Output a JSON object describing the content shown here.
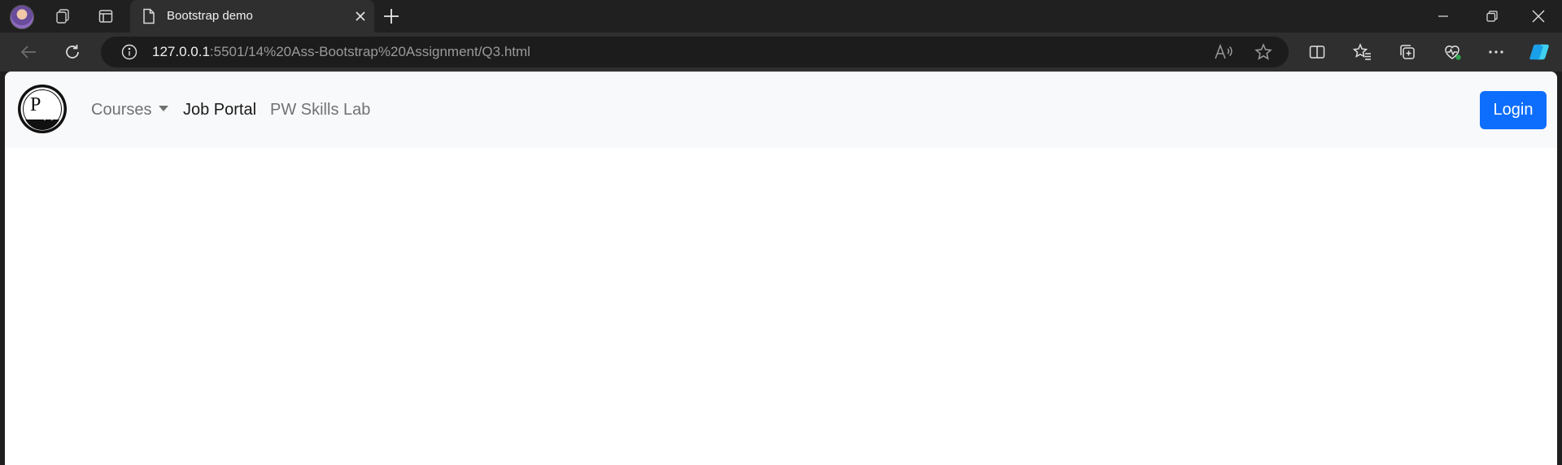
{
  "browser": {
    "tab": {
      "title": "Bootstrap demo",
      "icon": "page-icon"
    },
    "url": {
      "host": "127.0.0.1",
      "path": ":5501/14%20Ass-Bootstrap%20Assignment/Q3.html"
    }
  },
  "page": {
    "brand": {
      "logo_text": "PW",
      "icon": "pw-logo"
    },
    "nav": {
      "items": [
        {
          "label": "Courses",
          "dropdown": true,
          "active": false
        },
        {
          "label": "Job Portal",
          "dropdown": false,
          "active": true
        },
        {
          "label": "PW Skills Lab",
          "dropdown": false,
          "active": false
        }
      ]
    },
    "login_label": "Login"
  },
  "colors": {
    "primary": "#0d6efd",
    "navbar_bg": "#f8f9fa",
    "chrome_dark": "#202020",
    "chrome_toolbar": "#2f2f2f"
  }
}
